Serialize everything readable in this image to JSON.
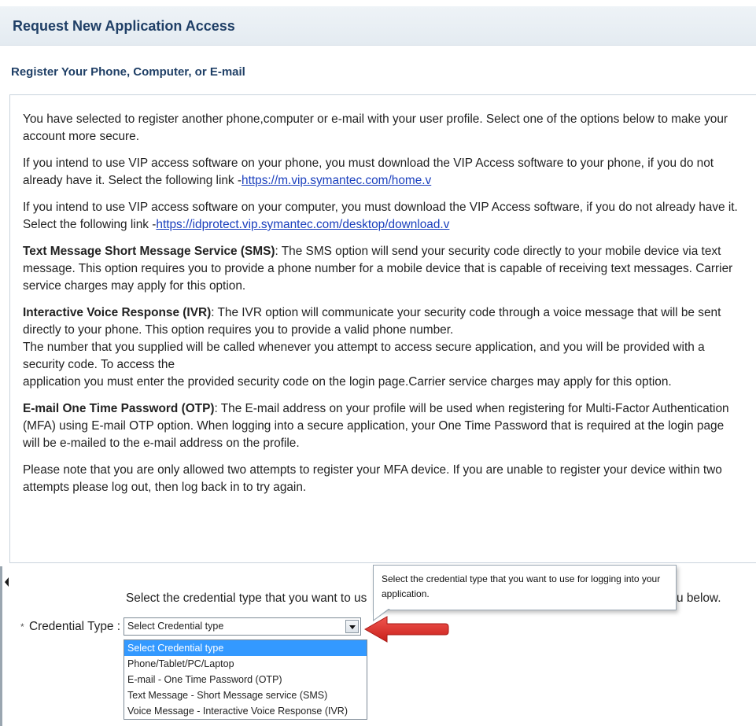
{
  "page_title": "Request New Application Access",
  "section_title": "Register Your Phone, Computer, or E-mail",
  "info": {
    "intro": "You have selected to register another phone,computer or e-mail with your user profile. Select one of the options below to make your account more secure.",
    "phone_text": "If you intend to use VIP access software on your phone, you must download the VIP Access software to your phone, if you do not already have it. Select the following link -",
    "phone_link": "https://m.vip.symantec.com/home.v",
    "computer_text": "If you intend to use VIP access software on your computer, you must download the VIP Access software, if you do not already have it. Select the following link -",
    "computer_link": "https://idprotect.vip.symantec.com/desktop/download.v",
    "sms_title": "Text Message Short Message Service (SMS)",
    "sms_text": ": The SMS option will send your security code directly to your mobile device via text message. This option requires you to provide a phone number for a mobile device that is capable of receiving text messages. Carrier service charges may apply for this option.",
    "ivr_title": "Interactive Voice Response (IVR)",
    "ivr_text": ": The IVR option will communicate your security code through a voice message that will be sent directly to your phone. This option requires you to provide a valid phone number.",
    "ivr_text2": "The number that you supplied will be called whenever you attempt to access secure application, and you will be provided with a security code. To access the",
    "ivr_text3": "application you must enter the provided security code on the login page.Carrier service charges may apply for this option.",
    "otp_title": "E-mail One Time Password (OTP)",
    "otp_text": ": The E-mail address on your profile will be used when registering for Multi-Factor Authentication (MFA) using E-mail OTP option. When logging into a secure application, your One Time Password that is required at the login page will be e-mailed to the e-mail address on the profile.",
    "note": "Please note that you are only allowed two attempts to register your MFA device. If you are unable to register your device within two attempts please log out, then log back in to try again."
  },
  "prompt": {
    "start": "Select the credential type that you want to us",
    "end": "u below."
  },
  "credential": {
    "required_mark": "*",
    "label": "Credential Type :",
    "selected": "Select Credential type",
    "options": [
      "Select Credential type",
      "Phone/Tablet/PC/Laptop",
      "E-mail - One Time Password (OTP)",
      "Text Message - Short Message service (SMS)",
      "Voice Message - Interactive Voice Response (IVR)"
    ]
  },
  "tooltip": {
    "text": "Select the credential type that you want to use for logging into your application."
  },
  "colors": {
    "title": "#1f3f66",
    "link": "#1a3fbd",
    "selected_option": "#3399ff",
    "arrow": "#e0302a"
  }
}
